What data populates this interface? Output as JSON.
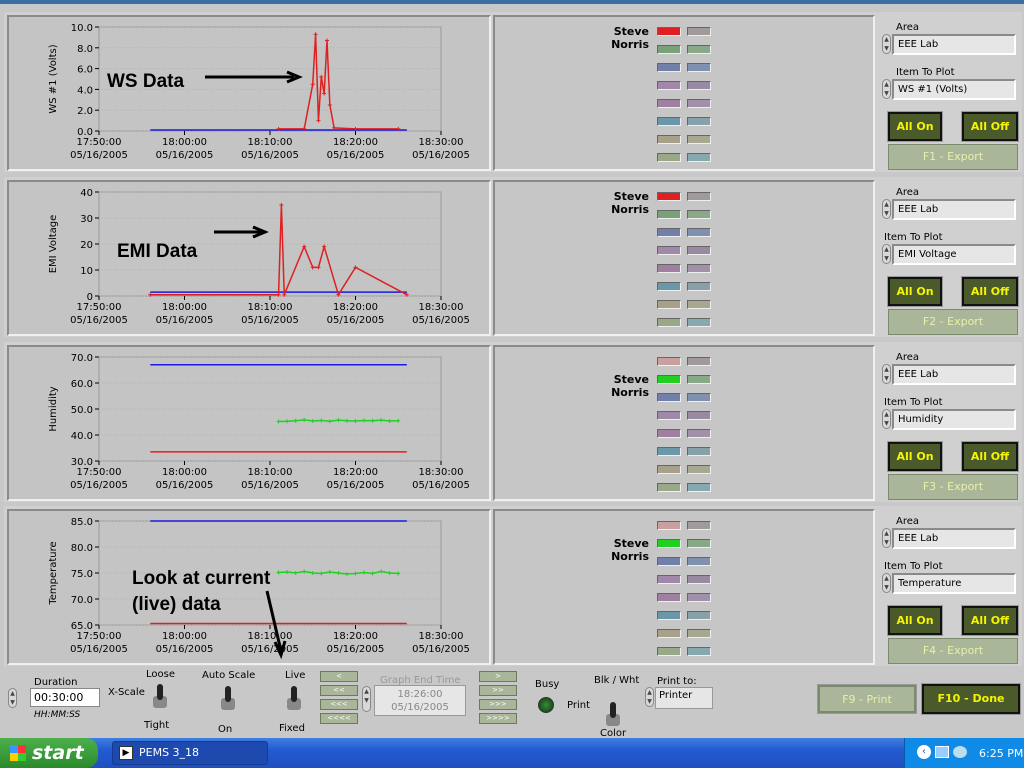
{
  "window": {
    "taskbar_item": "PEMS 3_18"
  },
  "panels": [
    {
      "ylabel": "WS #1 (Volts)",
      "yticks": [
        "10.0",
        "8.0",
        "6.0",
        "4.0",
        "2.0",
        "0.0"
      ],
      "annotation": "WS Data",
      "legend_name": "Steve Norris",
      "legend_active_color": "#e02020",
      "area_label": "Area",
      "area_value": "EEE Lab",
      "item_label": "Item To Plot",
      "item_value": "WS #1 (Volts)",
      "all_on": "All On",
      "all_off": "All Off",
      "export": "F1 - Export"
    },
    {
      "ylabel": "EMI Voltage",
      "yticks": [
        "40",
        "30",
        "20",
        "10",
        "0"
      ],
      "annotation": "EMI Data",
      "legend_name": "Steve Norris",
      "legend_active_color": "#e02020",
      "area_label": "Area",
      "area_value": "EEE Lab",
      "item_label": "Item To Plot",
      "item_value": "EMI Voltage",
      "all_on": "All On",
      "all_off": "All Off",
      "export": "F2 - Export"
    },
    {
      "ylabel": "Humidity",
      "yticks": [
        "70.0",
        "60.0",
        "50.0",
        "40.0",
        "30.0"
      ],
      "annotation": "",
      "legend_name": "Steve Norris",
      "legend_active_color": "#20d020",
      "area_label": "Area",
      "area_value": "EEE Lab",
      "item_label": "Item To Plot",
      "item_value": "Humidity",
      "all_on": "All On",
      "all_off": "All Off",
      "export": "F3 - Export"
    },
    {
      "ylabel": "Temperature",
      "yticks": [
        "85.0",
        "80.0",
        "75.0",
        "70.0",
        "65.0"
      ],
      "annotation": "Look at current\n(live) data",
      "legend_name": "Steve Norris",
      "legend_active_color": "#20d020",
      "area_label": "Area",
      "area_value": "EEE Lab",
      "item_label": "Item To Plot",
      "item_value": "Temperature",
      "all_on": "All On",
      "all_off": "All Off",
      "export": "F4 - Export"
    }
  ],
  "xticks": [
    {
      "time": "17:50:00",
      "date": "05/16/2005"
    },
    {
      "time": "18:00:00",
      "date": "05/16/2005"
    },
    {
      "time": "18:10:00",
      "date": "05/16/2005"
    },
    {
      "time": "18:20:00",
      "date": "05/16/2005"
    },
    {
      "time": "18:30:00",
      "date": "05/16/2005"
    }
  ],
  "chart_data": [
    {
      "type": "line",
      "ylabel": "WS #1 (Volts)",
      "ylim": [
        0,
        10
      ],
      "x_range": [
        "17:50:00",
        "18:30:00"
      ],
      "series": [
        {
          "color": "#1a1ae0",
          "x": [
            "17:56:00",
            "18:06:00",
            "18:16:00",
            "18:26:00"
          ],
          "values": [
            0.1,
            0.1,
            0.1,
            0.1
          ]
        },
        {
          "color": "#e02020",
          "x": [
            "18:11:00",
            "18:14:00",
            "18:15:00",
            "18:15:20",
            "18:15:40",
            "18:16:00",
            "18:16:20",
            "18:16:40",
            "18:17:00",
            "18:17:30",
            "18:20:00",
            "18:25:00"
          ],
          "values": [
            0.2,
            0.2,
            4.5,
            9.3,
            1.0,
            5.2,
            3.6,
            8.7,
            2.5,
            0.3,
            0.2,
            0.2
          ]
        }
      ]
    },
    {
      "type": "line",
      "ylabel": "EMI Voltage",
      "ylim": [
        0,
        40
      ],
      "x_range": [
        "17:50:00",
        "18:30:00"
      ],
      "series": [
        {
          "color": "#1a1ae0",
          "x": [
            "17:56:00",
            "18:26:00"
          ],
          "values": [
            1.5,
            1.5
          ]
        },
        {
          "color": "#e02020",
          "x": [
            "17:56:00",
            "18:11:00",
            "18:11:20",
            "18:11:40",
            "18:14:00",
            "18:15:00",
            "18:15:40",
            "18:16:20",
            "18:18:00",
            "18:20:00",
            "18:26:00"
          ],
          "values": [
            0.5,
            0.5,
            35,
            0.5,
            19,
            11,
            11,
            19,
            0.5,
            11,
            0.5
          ]
        }
      ]
    },
    {
      "type": "line",
      "ylabel": "Humidity",
      "ylim": [
        30,
        70
      ],
      "x_range": [
        "17:50:00",
        "18:30:00"
      ],
      "series": [
        {
          "color": "#1a1ae0",
          "x": [
            "17:56:00",
            "18:26:00"
          ],
          "values": [
            67,
            67
          ]
        },
        {
          "color": "#e02020",
          "x": [
            "17:56:00",
            "18:26:00"
          ],
          "values": [
            33.5,
            33.5
          ]
        },
        {
          "color": "#20d020",
          "x": [
            "18:11:00",
            "18:12:00",
            "18:13:00",
            "18:14:00",
            "18:15:00",
            "18:16:00",
            "18:17:00",
            "18:18:00",
            "18:19:00",
            "18:20:00",
            "18:21:00",
            "18:22:00",
            "18:23:00",
            "18:24:00",
            "18:25:00"
          ],
          "values": [
            45.2,
            45.3,
            45.5,
            45.8,
            45.4,
            45.6,
            45.3,
            45.7,
            45.5,
            45.4,
            45.6,
            45.5,
            45.7,
            45.4,
            45.5
          ]
        }
      ]
    },
    {
      "type": "line",
      "ylabel": "Temperature",
      "ylim": [
        65,
        85
      ],
      "x_range": [
        "17:50:00",
        "18:30:00"
      ],
      "series": [
        {
          "color": "#1a1ae0",
          "x": [
            "17:56:00",
            "18:26:00"
          ],
          "values": [
            85,
            85
          ]
        },
        {
          "color": "#e02020",
          "x": [
            "17:56:00",
            "18:26:00"
          ],
          "values": [
            65.3,
            65.3
          ]
        },
        {
          "color": "#20d020",
          "x": [
            "18:11:00",
            "18:12:00",
            "18:13:00",
            "18:14:00",
            "18:15:00",
            "18:16:00",
            "18:17:00",
            "18:18:00",
            "18:19:00",
            "18:20:00",
            "18:21:00",
            "18:22:00",
            "18:23:00",
            "18:24:00",
            "18:25:00"
          ],
          "values": [
            75.1,
            75.2,
            75.0,
            75.3,
            75.0,
            74.9,
            75.2,
            75.0,
            74.8,
            74.9,
            75.1,
            74.9,
            75.3,
            75.0,
            74.9
          ]
        }
      ]
    }
  ],
  "bottom": {
    "duration_label": "Duration",
    "duration_value": "00:30:00",
    "duration_format": "HH:MM:SS",
    "xscale_label": "X-Scale",
    "loose": "Loose",
    "tight": "Tight",
    "autoscale": "Auto Scale",
    "on": "On",
    "live": "Live",
    "fixed": "Fixed",
    "graph_end_label": "Graph End Time",
    "graph_end_time": "18:26:00",
    "graph_end_date": "05/16/2005",
    "nav_left": [
      "<",
      "<<",
      "<<<",
      "<<<<"
    ],
    "nav_right": [
      ">",
      ">>",
      ">>>",
      ">>>>"
    ],
    "busy": "Busy",
    "blk_wht": "Blk / Wht",
    "print": "Print",
    "color": "Color",
    "print_to": "Print to:",
    "printer": "Printer",
    "f9": "F9 - Print",
    "f10": "F10 - Done"
  },
  "taskbar": {
    "start": "start",
    "item": "PEMS 3_18",
    "clock": "6:25 PM"
  }
}
